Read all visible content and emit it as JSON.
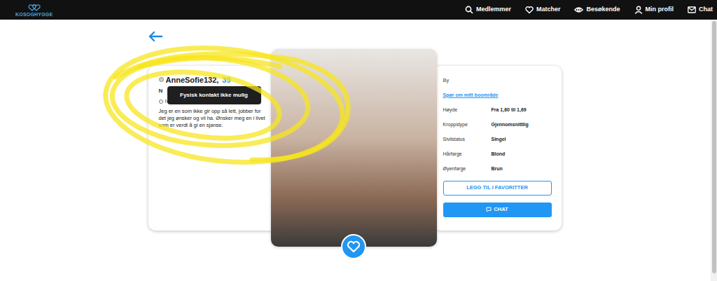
{
  "nav": {
    "logo": "KOSOGHYGGE",
    "items": [
      {
        "label": "Medlemmer",
        "kind": "search"
      },
      {
        "label": "Matcher",
        "kind": "heart"
      },
      {
        "label": "Besøkende",
        "kind": "eye"
      },
      {
        "label": "Min profil",
        "kind": "user"
      },
      {
        "label": "Chat",
        "kind": "mail"
      }
    ]
  },
  "profile": {
    "username": "AnneSofie132,",
    "age": "39",
    "online": false,
    "line1": "N",
    "line2": "N",
    "description": "Jeg er en som ikke gir opp så lett, jobber for det jeg ønsker og vil ha. Ønsker meg en i livet som er verdt å gi en sjanse."
  },
  "tooltip": "Fysisk kontakt ikke mulig",
  "details": {
    "city_label": "By",
    "area_link": "Spør om mitt boområde",
    "rows": [
      {
        "label": "Høyde",
        "value": "Fra 1,60 til 1,69"
      },
      {
        "label": "Kroppstype",
        "value": "Gjennomsnittlig"
      },
      {
        "label": "Sivilstatus",
        "value": "Singel"
      },
      {
        "label": "Hårfarge",
        "value": "Blond"
      },
      {
        "label": "Øyenfarge",
        "value": "Brun"
      }
    ]
  },
  "buttons": {
    "favorite": "LEGG TIL I FAVORITTER",
    "chat": "CHAT"
  }
}
